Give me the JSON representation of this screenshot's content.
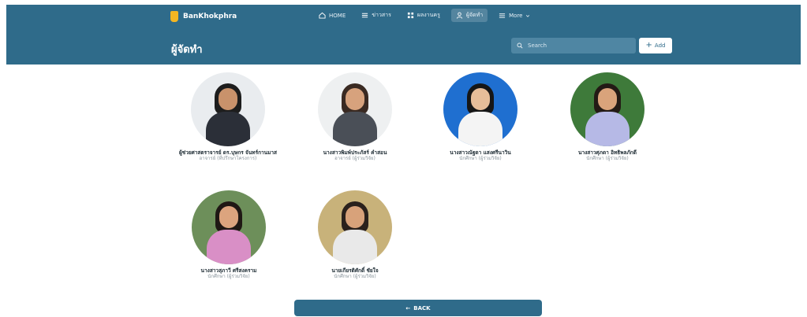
{
  "app": {
    "brand": "BanKhokphra"
  },
  "nav": [
    {
      "label": "HOME",
      "icon": "home-icon"
    },
    {
      "label": "ข่าวสาร",
      "icon": "list-icon"
    },
    {
      "label": "ผลงานครู",
      "icon": "grid-icon"
    },
    {
      "label": "ผู้จัดทำ",
      "icon": "user-icon",
      "active": true
    },
    {
      "label": "More",
      "icon": "menu-icon"
    }
  ],
  "page": {
    "title": "ผู้จัดทำ"
  },
  "search": {
    "placeholder": "Search"
  },
  "add": {
    "label": "Add"
  },
  "members": [
    {
      "name": "ผู้ช่วยศาสตราจารย์ ดร.บุษกร จันทร์กานมาส",
      "role": "อาจารย์ (ที่ปรึกษาโครงการ)",
      "bg": "#e9ecef",
      "skin": "#c9926b",
      "hair": "#1d1d1d",
      "shirt": "#2b2f38"
    },
    {
      "name": "นางสาวพิมพ์ประภัสร์ คำสอน",
      "role": "อาจารย์ (ผู้ร่วมวิจัย)",
      "bg": "#eef0f1",
      "skin": "#d7a27d",
      "hair": "#3a2a22",
      "shirt": "#4a4f57"
    },
    {
      "name": "นางสาวณัฐดา แสงศรีนาวิน",
      "role": "นักศึกษา (ผู้ร่วมวิจัย)",
      "bg": "#1f6fd0",
      "skin": "#e6bd99",
      "hair": "#161616",
      "shirt": "#f4f4f4"
    },
    {
      "name": "นางสาวศุภดา อิทธิพลภักดี",
      "role": "นักศึกษา (ผู้ร่วมวิจัย)",
      "bg": "#3e7a3a",
      "skin": "#d9a37b",
      "hair": "#231a15",
      "shirt": "#b6b9e6"
    },
    {
      "name": "นางสาวสุภาวี ศรีสงคราม",
      "role": "นักศึกษา (ผู้ร่วมวิจัย)",
      "bg": "#6d8f5a",
      "skin": "#dca47e",
      "hair": "#1f1814",
      "shirt": "#d98fc6"
    },
    {
      "name": "นายเกียรติศักดิ์ ชัยใจ",
      "role": "นักศึกษา (ผู้ร่วมวิจัย)",
      "bg": "#c8b27a",
      "skin": "#d8a27a",
      "hair": "#2a211c",
      "shirt": "#e9e9e9"
    }
  ],
  "back": {
    "label": "BACK"
  }
}
